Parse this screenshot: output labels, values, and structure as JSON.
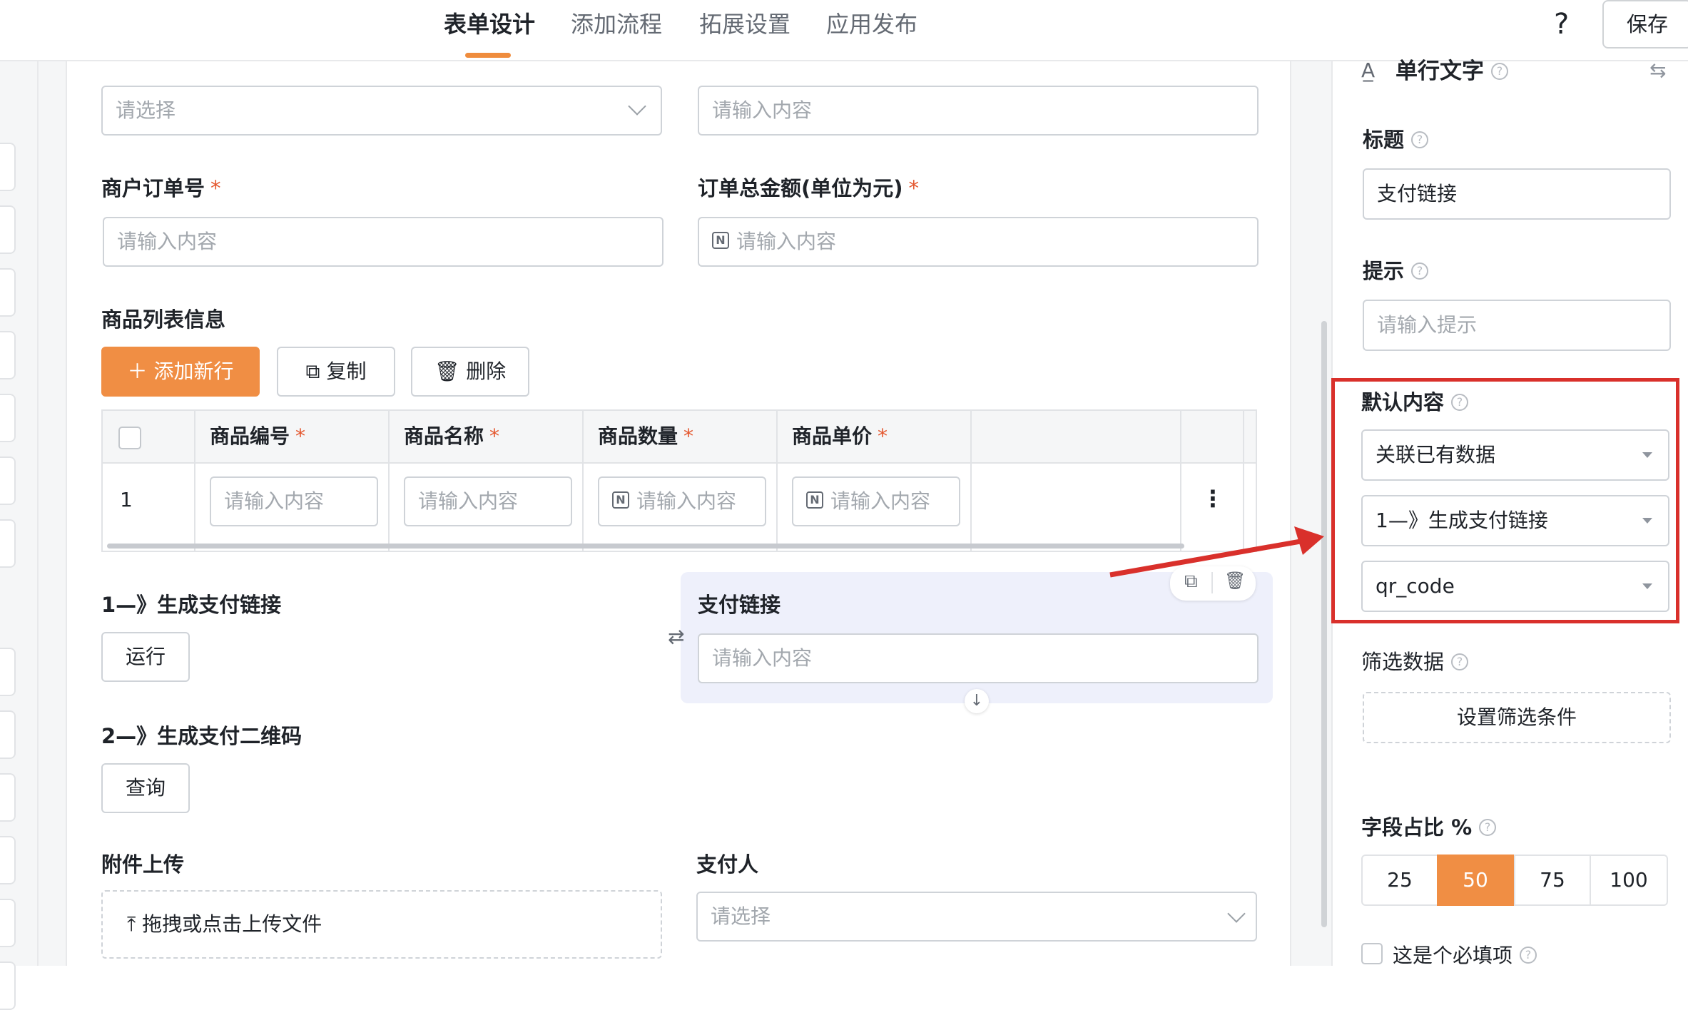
{
  "header": {
    "tabs": [
      {
        "label": "表单设计",
        "active": true
      },
      {
        "label": "添加流程",
        "active": false
      },
      {
        "label": "拓展设置",
        "active": false
      },
      {
        "label": "应用发布",
        "active": false
      }
    ],
    "help": "?",
    "save": "保存"
  },
  "form": {
    "top_select_placeholder": "请选择",
    "top_input_placeholder": "请输入内容",
    "merchant_order_label": "商户订单号",
    "merchant_order_placeholder": "请输入内容",
    "total_amount_label": "订单总金额(单位为元)",
    "total_amount_placeholder": "请输入内容",
    "required_mark": "*",
    "goods_list_label": "商品列表信息",
    "add_row": "添加新行",
    "copy": "复制",
    "delete": "删除",
    "table": {
      "columns": [
        "商品编号",
        "商品名称",
        "商品数量",
        "商品单价"
      ],
      "row_index": "1",
      "cell_placeholder": "请输入内容",
      "more": "⋮"
    },
    "step1_label": "1—》生成支付链接",
    "run": "运行",
    "pay_link_label": "支付链接",
    "pay_link_placeholder": "请输入内容",
    "step2_label": "2—》生成支付二维码",
    "query": "查询",
    "attachment_label": "附件上传",
    "upload_text": "拖拽或点击上传文件",
    "payer_label": "支付人",
    "payer_placeholder": "请选择"
  },
  "panel": {
    "component_name": "单行文字",
    "title_label": "标题",
    "title_value": "支付链接",
    "hint_label": "提示",
    "hint_placeholder": "请输入提示",
    "default_label": "默认内容",
    "default_mode": "关联已有数据",
    "default_source": "1—》生成支付链接",
    "default_field": "qr_code",
    "filter_label": "筛选数据",
    "filter_button": "设置筛选条件",
    "ratio_label": "字段占比 %",
    "ratio_options": [
      "25",
      "50",
      "75",
      "100"
    ],
    "ratio_selected": "50",
    "required_label": "这是个必填项"
  },
  "colors": {
    "accent": "#f08e44",
    "highlight": "#d9302b"
  }
}
